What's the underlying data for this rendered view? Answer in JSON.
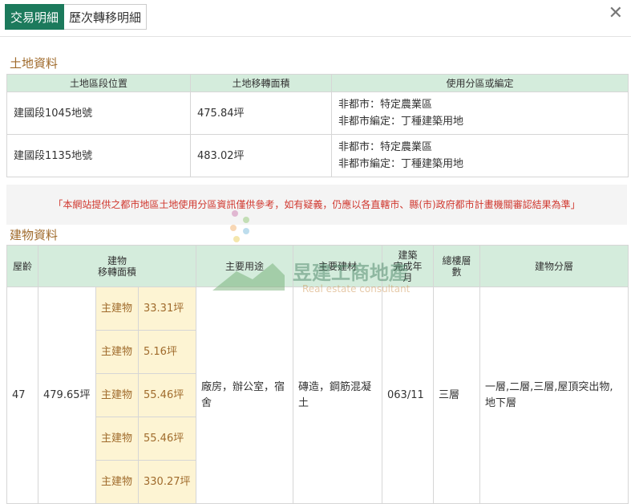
{
  "tabs": [
    "交易明細",
    "歷次轉移明細"
  ],
  "close_label": "✕",
  "land": {
    "title": "土地資料",
    "headers": [
      "土地區段位置",
      "土地移轉面積",
      "使用分區或編定"
    ],
    "rows": [
      {
        "location": "建國段1045地號",
        "area": "475.84坪",
        "zone1": "非都市：特定農業區",
        "zone2": "非都市編定：丁種建築用地"
      },
      {
        "location": "建國段1135地號",
        "area": "483.02坪",
        "zone1": "非都市：特定農業區",
        "zone2": "非都市編定：丁種建築用地"
      }
    ]
  },
  "notice": "「本網站提供之都市地區土地使用分區資訊僅供參考，如有疑義，仍應以各直轄市、縣(市)政府都市計畫機關審認結果為準」",
  "building": {
    "title": "建物資料",
    "headers": {
      "age": "屋齡",
      "area": "建物\n移轉面積",
      "use": "主要用途",
      "material": "主要建材",
      "completed": "建築\n完成年\n月",
      "floors": "總樓層\n數",
      "levels": "建物分層"
    },
    "row": {
      "age": "47",
      "total_area": "479.65坪",
      "use": "廠房，辦公室，宿舍",
      "material": "磚造，鋼筋混凝土",
      "completed": "063/11",
      "floors": "三層",
      "levels": "一層,二層,三層,屋頂突出物,地下層"
    },
    "sub_rows": [
      {
        "label": "主建物",
        "area": "33.31坪"
      },
      {
        "label": "主建物",
        "area": "5.16坪"
      },
      {
        "label": "主建物",
        "area": "55.46坪"
      },
      {
        "label": "主建物",
        "area": "55.46坪"
      },
      {
        "label": "主建物",
        "area": "330.27坪"
      }
    ]
  },
  "watermark": {
    "name": "昱建工商地產",
    "sub": "Real estate consultant"
  }
}
